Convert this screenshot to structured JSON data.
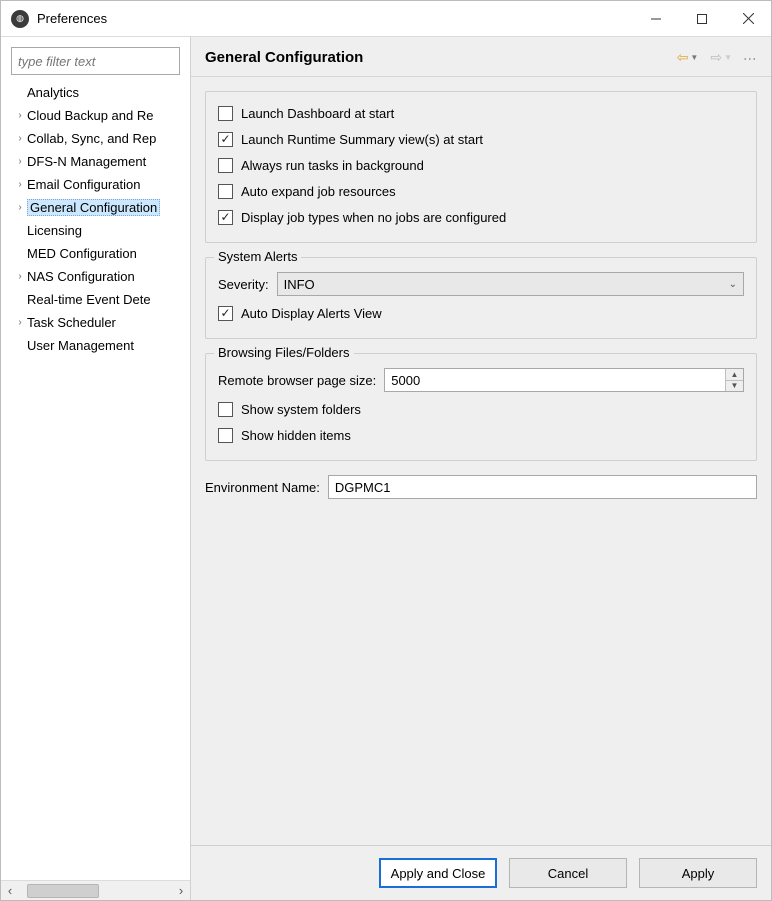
{
  "window": {
    "title": "Preferences"
  },
  "sidebar": {
    "filter_placeholder": "type filter text",
    "items": [
      {
        "label": "Analytics",
        "expandable": false,
        "selected": false
      },
      {
        "label": "Cloud Backup and Re",
        "expandable": true,
        "selected": false
      },
      {
        "label": "Collab, Sync, and Rep",
        "expandable": true,
        "selected": false
      },
      {
        "label": "DFS-N Management",
        "expandable": true,
        "selected": false
      },
      {
        "label": "Email Configuration",
        "expandable": true,
        "selected": false
      },
      {
        "label": "General Configuration",
        "expandable": true,
        "selected": true
      },
      {
        "label": "Licensing",
        "expandable": false,
        "selected": false
      },
      {
        "label": "MED Configuration",
        "expandable": false,
        "selected": false
      },
      {
        "label": "NAS Configuration",
        "expandable": true,
        "selected": false
      },
      {
        "label": "Real-time Event Dete",
        "expandable": false,
        "selected": false
      },
      {
        "label": "Task Scheduler",
        "expandable": true,
        "selected": false
      },
      {
        "label": "User Management",
        "expandable": false,
        "selected": false
      }
    ]
  },
  "page": {
    "heading": "General Configuration"
  },
  "general_checks": {
    "launch_dashboard": {
      "label": "Launch Dashboard at start",
      "checked": false
    },
    "launch_runtime_summary": {
      "label": "Launch Runtime Summary view(s) at start",
      "checked": true
    },
    "always_background": {
      "label": "Always run tasks in background",
      "checked": false
    },
    "auto_expand_resources": {
      "label": "Auto expand job resources",
      "checked": false
    },
    "display_job_types": {
      "label": "Display job types when no jobs are configured",
      "checked": true
    }
  },
  "system_alerts": {
    "group_label": "System Alerts",
    "severity_label": "Severity:",
    "severity_value": "INFO",
    "auto_display": {
      "label": "Auto Display Alerts View",
      "checked": true
    }
  },
  "browsing": {
    "group_label": "Browsing Files/Folders",
    "page_size_label": "Remote browser page size:",
    "page_size_value": "5000",
    "show_system_folders": {
      "label": "Show system folders",
      "checked": false
    },
    "show_hidden_items": {
      "label": "Show hidden items",
      "checked": false
    }
  },
  "environment": {
    "label": "Environment Name:",
    "value": "DGPMC1"
  },
  "buttons": {
    "apply_close": "Apply and Close",
    "cancel": "Cancel",
    "apply": "Apply"
  }
}
